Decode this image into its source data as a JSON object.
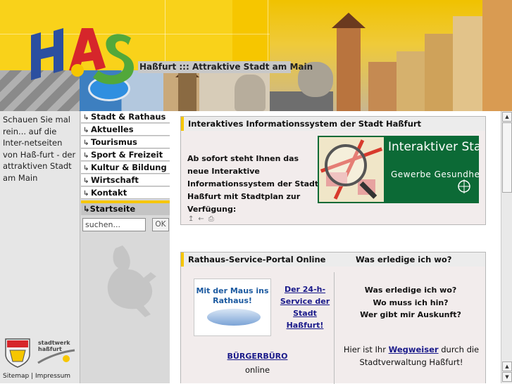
{
  "header": {
    "logo_text": "HAS",
    "tagline": "Haßfurt ::: Attraktive Stadt am Main"
  },
  "left": {
    "intro": "Schauen Sie mal rein... auf die Inter-netseiten von Haß-furt - der attraktiven Stadt am Main",
    "stadtwerk_logo_text": "stadtwerk haßfurt",
    "footer": "Sitemap | Impressum"
  },
  "nav": {
    "items": [
      {
        "label": "Stadt & Rathaus"
      },
      {
        "label": "Aktuelles"
      },
      {
        "label": "Tourismus"
      },
      {
        "label": "Sport & Freizeit"
      },
      {
        "label": "Kultur & Bildung"
      },
      {
        "label": "Wirtschaft"
      },
      {
        "label": "Kontakt"
      }
    ],
    "home": "Startseite",
    "arrow_icon": "↳",
    "search_placeholder": "suchen...",
    "search_button": "OK"
  },
  "box1": {
    "title": "Interaktives Informationssystem der Stadt Haßfurt",
    "text": "Ab sofort steht Ihnen das neue Interaktive Informationssystem der Stadt Haßfurt mit Stadtplan zur Verfügung:",
    "banner_title": "Interaktiver Stadtplan",
    "banner_subtitle": "Gewerbe Gesundheit Tourismus",
    "icons": [
      "top-icon",
      "back-icon",
      "print-icon"
    ]
  },
  "box2": {
    "title_left": "Rathaus-Service-Portal Online",
    "title_right": "Was erledige ich wo?",
    "mouse_card_text": "Mit der Maus ins Rathaus!",
    "service_link": "Der 24-h-Service der Stadt Haßfurt!",
    "buergerbuero": "BÜRGERBÜRO",
    "online": "online",
    "questions": [
      "Was erledige ich wo?",
      "Wo muss ich hin?",
      "Wer gibt mir Auskunft?"
    ],
    "wegweiser_before": "Hier ist Ihr ",
    "wegweiser_link": "Wegweiser",
    "wegweiser_after": " durch die Stadtverwaltung Haßfurt!"
  },
  "colors": {
    "accent_yellow": "#f6c600",
    "link": "#1a1a8a",
    "banner_green": "#0c6a36"
  }
}
